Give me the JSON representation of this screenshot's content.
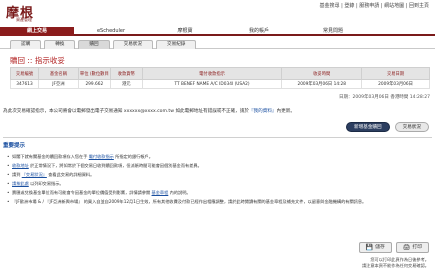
{
  "header": {
    "logo": "摩根",
    "logo_sub": "資產管理",
    "top_links": "基金搜尋 | 登錄 | 服務申請 | 網站地圖 | 回到主頁"
  },
  "nav": {
    "items": [
      {
        "label": "網上交易",
        "active": true
      },
      {
        "label": "eScheduler",
        "active": false
      },
      {
        "label": "摩根寶",
        "active": false
      },
      {
        "label": "我的帳戶",
        "active": false
      },
      {
        "label": "常見問題",
        "active": false
      }
    ]
  },
  "subnav": {
    "tabs": [
      {
        "label": "認購",
        "active": false
      },
      {
        "label": "轉換",
        "active": false
      },
      {
        "label": "贖回",
        "active": true
      },
      {
        "label": "交易狀況",
        "active": false
      },
      {
        "label": "交易紀錄",
        "active": false
      }
    ]
  },
  "page_title": "贖回 :: 指示收妥",
  "table": {
    "headers": [
      "交易編號",
      "基金名稱",
      "單位\n(數位數目",
      "收款貨幣",
      "電付收款指示",
      "收妥時間",
      "交易日期"
    ],
    "rows": [
      [
        "347613",
        "JF亞洲",
        "299.662",
        "港元",
        "TT BENEF NAME A/C ID034I (USA2)",
        "2009年03月06日 14:28",
        "2009年03月06日"
      ]
    ],
    "footer": "日期：2009年03月06日 香港時間 14:28:27"
  },
  "email_note": {
    "prefix": "為此次交易確認指示，本公司將會以電郵發出電子交易通知 ",
    "email": "xxxxxx@xxxx.com.tw",
    "suffix": " 如此電郵地址有錯誤或不正確，請於",
    "link": "『我的資料』",
    "end": "內更新。"
  },
  "buttons": {
    "primary": "新增基金贖回",
    "secondary": "交易狀況"
  },
  "notes": {
    "title": "重要提示",
    "items": [
      {
        "text": "如閣下就有關基金的贖回款項存入您在手 ",
        "link": "電付收款指示",
        "tail": " 所指定的銀行帳戶。"
      },
      {
        "text": "",
        "link": "收款地址",
        "tail": " 於正常情況下，將如常於下個交易日收到贖回款項，但派賬時間可能會因個別基金而有差異。"
      },
      {
        "text": "請到 ",
        "link": "『交易狀況』",
        "tail": " 查看此交易的詳細資料。"
      },
      {
        "text": "",
        "link": "請按此處",
        "tail": " 以列印交易指示。"
      },
      {
        "text": "賣匯或兌換基金單位而有可能會令因基金的單位價值受到影響，詳情請參閱 ",
        "link": "基金章程",
        "tail": " 內的說明。"
      },
      {
        "text": "『JF歐洲市場 & / 『JF亞洲新興市場』 的買入自並自2009年12月1日生效，所有其他收費及付款已經作出相應調整，請於此時閱讀有關的基金章程及補充文件，以留意與金融機構的有關訊息。",
        "link": "",
        "tail": ""
      }
    ]
  },
  "bottom_buttons": {
    "save": "儲存",
    "print": "打印"
  },
  "footer": {
    "line1": "您可以打印此頁作為日後參考。",
    "line2": "請注意本頁不能作為任何交易確認。"
  }
}
